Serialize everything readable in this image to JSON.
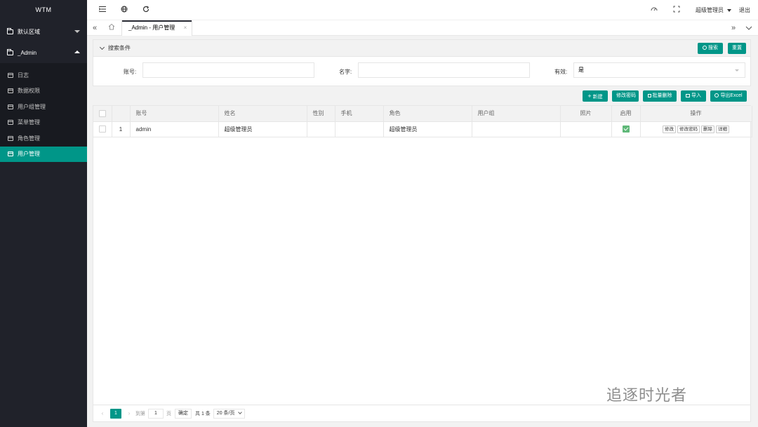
{
  "sidebar": {
    "logo": "WTM",
    "groups": [
      {
        "label": "默认区域",
        "expanded": false
      },
      {
        "label": "_Admin",
        "expanded": true
      }
    ],
    "items": [
      "日志",
      "数据权限",
      "用户组管理",
      "菜单管理",
      "角色管理",
      "用户管理"
    ],
    "active_item": "用户管理"
  },
  "topbar": {
    "user": "超级管理员",
    "logout": "退出",
    "icons": [
      "menu-fold-icon",
      "globe-icon",
      "refresh-icon",
      "theme-icon",
      "fullscreen-icon"
    ]
  },
  "tabs": {
    "active": "_Admin - 用户管理",
    "close": "×"
  },
  "search": {
    "title": "搜索条件",
    "search_btn": "搜索",
    "reset_btn": "重置",
    "account_label": "账号:",
    "account_value": "",
    "name_label": "名字:",
    "name_value": "",
    "valid_label": "有效:",
    "valid_value": "是"
  },
  "toolbar": {
    "new": "新建",
    "change_pwd": "修改密码",
    "batch_delete": "批量删除",
    "import": "导入",
    "export": "导出Excel"
  },
  "table": {
    "headers": [
      "",
      "",
      "账号",
      "姓名",
      "性别",
      "手机",
      "角色",
      "用户组",
      "照片",
      "启用",
      "操作"
    ],
    "rows": [
      {
        "index": "1",
        "account": "admin",
        "name": "超级管理员",
        "gender": "",
        "phone": "",
        "role": "超级管理员",
        "group": "",
        "photo": "",
        "enabled": true,
        "actions": [
          "修改",
          "修改密码",
          "删除",
          "详细"
        ]
      }
    ]
  },
  "pager": {
    "current": "1",
    "goto_label": "到第",
    "goto_value": "1",
    "page_unit": "页",
    "confirm": "确定",
    "total": "共 1 条",
    "page_size": "20 条/页"
  },
  "watermark": "追逐时光者",
  "colors": {
    "accent": "#009688",
    "sidebar": "#20222a",
    "sidebar_sub": "#181a20"
  }
}
